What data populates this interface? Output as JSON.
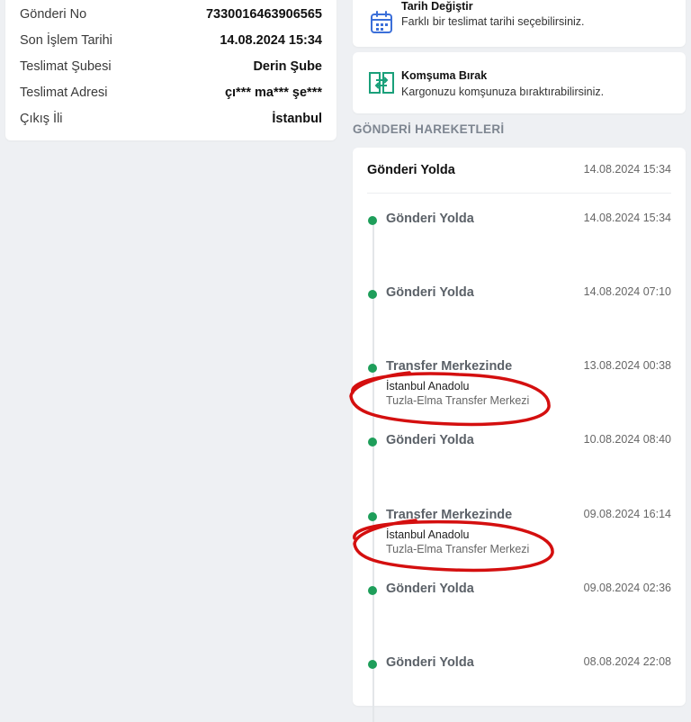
{
  "shipment_info": {
    "rows": [
      {
        "label": "Gönderi No",
        "value": "7330016463906565"
      },
      {
        "label": "Son İşlem Tarihi",
        "value": "14.08.2024 15:34"
      },
      {
        "label": "Teslimat Şubesi",
        "value": "Derin Şube"
      },
      {
        "label": "Teslimat Adresi",
        "value": "çı*** ma*** şe***"
      },
      {
        "label": "Çıkış İli",
        "value": "İstanbul"
      }
    ]
  },
  "actions": {
    "change_date": {
      "title": "Tarih Değiştir",
      "subtitle": "Farklı bir teslimat tarihi seçebilirsiniz.",
      "icon": "calendar-icon"
    },
    "leave_neighbor": {
      "title": "Komşuma Bırak",
      "subtitle": "Kargonuzu komşunuza bıraktırabilirsiniz.",
      "icon": "door-exchange-icon"
    }
  },
  "section_title": "GÖNDERİ HAREKETLERİ",
  "timeline": {
    "header": {
      "status": "Gönderi Yolda",
      "date": "14.08.2024 15:34"
    },
    "events": [
      {
        "status": "Gönderi Yolda",
        "date": "14.08.2024 15:34"
      },
      {
        "status": "Gönderi Yolda",
        "date": "14.08.2024 07:10"
      },
      {
        "status": "Transfer Merkezinde",
        "date": "13.08.2024 00:38",
        "line1": "İstanbul Anadolu",
        "line2": "Tuzla-Elma Transfer Merkezi"
      },
      {
        "status": "Gönderi Yolda",
        "date": "10.08.2024 08:40"
      },
      {
        "status": "Transfer Merkezinde",
        "date": "09.08.2024 16:14",
        "line1": "İstanbul Anadolu",
        "line2": "Tuzla-Elma Transfer Merkezi"
      },
      {
        "status": "Gönderi Yolda",
        "date": "09.08.2024 02:36"
      },
      {
        "status": "Gönderi Yolda",
        "date": "08.08.2024 22:08"
      }
    ]
  },
  "colors": {
    "accent_green": "#1e9e5a",
    "icon_blue": "#3b6fd9",
    "icon_teal": "#1aa07a",
    "annotation_red": "#d40f0f"
  }
}
